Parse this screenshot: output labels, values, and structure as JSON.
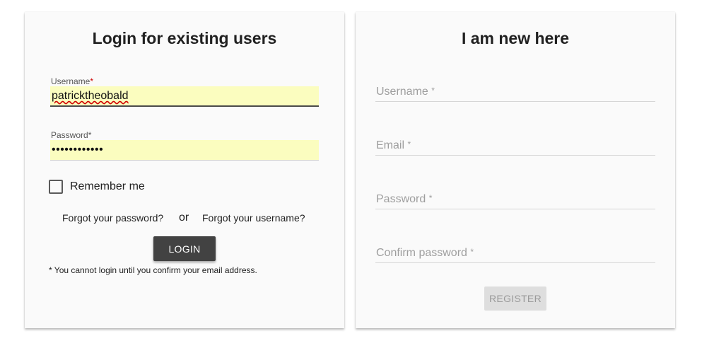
{
  "login": {
    "title": "Login for existing users",
    "username": {
      "label": "Username",
      "required_mark": "*",
      "value": "patricktheobald"
    },
    "password": {
      "label": "Password",
      "required_mark": "*",
      "value": "••••••••••••"
    },
    "remember_label": "Remember me",
    "remember_checked": false,
    "forgot_password": "Forgot your password?",
    "or_text": "or",
    "forgot_username": "Forgot your username?",
    "login_button": "LOGIN",
    "note": "* You cannot login until you confirm your email address."
  },
  "register": {
    "title": "I am new here",
    "fields": [
      {
        "label": "Username",
        "required_mark": "*"
      },
      {
        "label": "Email",
        "required_mark": "*"
      },
      {
        "label": "Password",
        "required_mark": "*"
      },
      {
        "label": "Confirm password",
        "required_mark": "*"
      }
    ],
    "register_button": "REGISTER"
  },
  "colors": {
    "autofill_bg": "#fbfdbf",
    "login_button_bg": "#424242",
    "register_button_bg": "#dedede",
    "required_mark": "#cc0000"
  }
}
